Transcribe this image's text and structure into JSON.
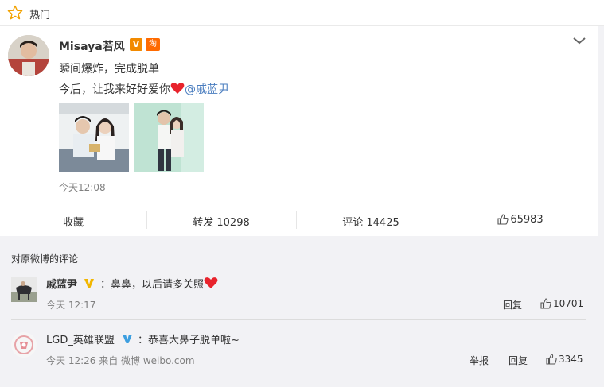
{
  "header": {
    "title": "热门"
  },
  "post": {
    "author": "Misaya若风",
    "vip_badge": "V",
    "taobao_badge": "淘",
    "text_line1": "瞬间爆炸，完成脱单",
    "text_line2_prefix": "今后，让我来好好爱你",
    "mention": "@戚蓝尹",
    "time": "今天12:08",
    "actions": {
      "favorite": "收藏",
      "repost": "转发 10298",
      "comment": "评论 14425",
      "like": "65983"
    }
  },
  "comments_section": {
    "title": "对原微博的评论",
    "comments": [
      {
        "name": "戚蓝尹",
        "text": "：鼻鼻，以后请多关照",
        "time": "今天 12:17",
        "reply": "回复",
        "likes": "10701"
      },
      {
        "name": "LGD_英雄联盟",
        "text": "：恭喜大鼻子脱单啦~",
        "time": "今天 12:26 来自 微博 weibo.com",
        "report": "举报",
        "reply": "回复",
        "likes": "3345"
      }
    ]
  },
  "colors": {
    "accent_link": "#4a7dbf",
    "vip_orange": "#f28a00",
    "heart_red": "#e8232c"
  }
}
